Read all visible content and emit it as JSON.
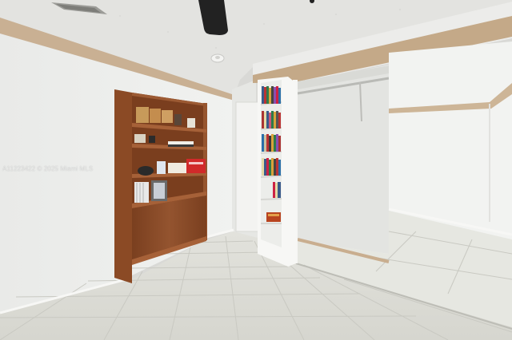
{
  "watermark": "A11223422 © 2025 Miami MLS",
  "colors": {
    "wall": "#ecedeb",
    "ceiling": "#e4e4e2",
    "trim": "#c8ae90",
    "wood": "#8a4a26",
    "floor": "#ddddd6"
  },
  "icons": [
    "ceiling-fan-blade",
    "air-vent",
    "smoke-detector"
  ]
}
